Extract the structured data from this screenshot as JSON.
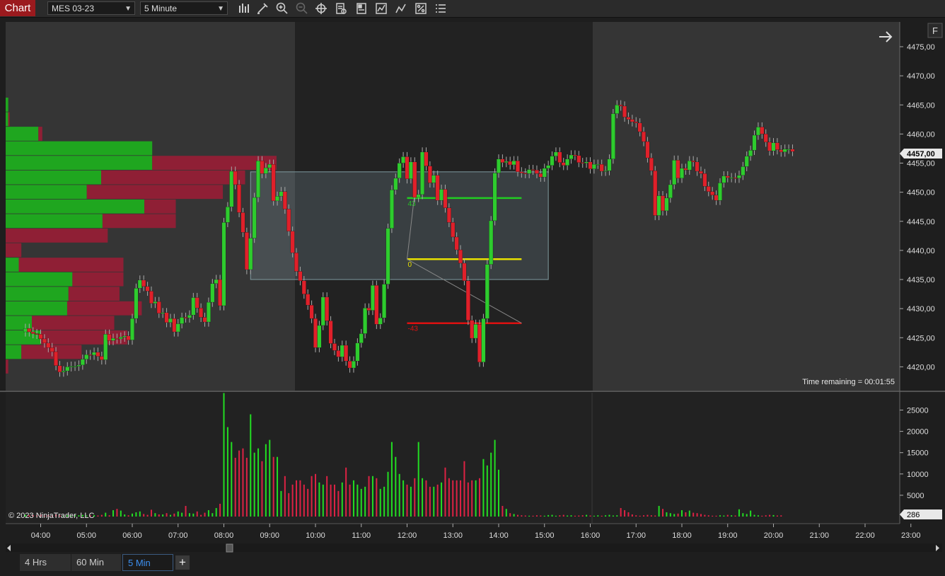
{
  "toolbar": {
    "chart_tab": "Chart",
    "instrument": "MES 03-23",
    "interval": "5 Minute",
    "icons": [
      "bar-type-icon",
      "drawing-tool-icon",
      "zoom-in-icon",
      "zoom-out-icon",
      "crosshair-icon",
      "data-box-icon",
      "properties-icon",
      "strategies-icon",
      "indicators-icon",
      "trade-icon",
      "chart-trader-icon"
    ]
  },
  "chart": {
    "time_remaining": "Time remaining = 00:01:55",
    "copyright": "© 2023 NinjaTrader, LLC",
    "last_price_label": "4457,00",
    "last_volume_label": "286",
    "f_button": "F",
    "colors": {
      "up": "#2ecc2e",
      "down": "#e0202a",
      "bg_extended": "#353535",
      "bg_rth": "#222222",
      "volume_up": "#22dd22",
      "volume_down": "#dd2244"
    },
    "price_ticks": [
      "4475,00",
      "4470,00",
      "4465,00",
      "4460,00",
      "4455,00",
      "4450,00",
      "4445,00",
      "4440,00",
      "4435,00",
      "4430,00",
      "4425,00",
      "4420,00"
    ],
    "volume_ticks": [
      "25000",
      "20000",
      "15000",
      "10000",
      "5000"
    ],
    "time_ticks": [
      "04:00",
      "05:00",
      "06:00",
      "07:00",
      "08:00",
      "09:00",
      "10:00",
      "11:00",
      "12:00",
      "13:00",
      "14:00",
      "15:00",
      "16:00",
      "17:00",
      "18:00",
      "19:00",
      "20:00",
      "21:00",
      "22:00",
      "23:00"
    ],
    "fib_labels": {
      "top": "43",
      "mid": "0",
      "bottom": "-43"
    }
  },
  "chart_data": {
    "type": "candlestick",
    "session_start": "03:40",
    "bar_minutes": 5,
    "price_range": [
      4416.5,
      4477.5
    ],
    "volume_range": [
      0,
      29000
    ],
    "rth_session": [
      "09:30",
      "16:00"
    ],
    "closes": [
      4426.6,
      4426.0,
      4425.7,
      4425.6,
      4424.8,
      4424.1,
      4423.3,
      4422.6,
      4420.2,
      4419.1,
      4419.3,
      4420.0,
      4420.1,
      4420.1,
      4420.3,
      4421.3,
      4422.1,
      4422.0,
      4422.5,
      4421.8,
      4421.2,
      4425.6,
      4424.5,
      4424.9,
      4424.8,
      4425.1,
      4425.3,
      4424.6,
      4428.3,
      4433.5,
      4434.9,
      4433.8,
      4433.0,
      4430.9,
      4431.2,
      4429.2,
      4429.3,
      4427.6,
      4428.3,
      4426.0,
      4427.4,
      4428.5,
      4428.4,
      4428.9,
      4431.9,
      4430.1,
      4428.5,
      4427.7,
      4431.1,
      4434.3,
      4435.0,
      4430.5,
      4444.8,
      4447.5,
      4453.6,
      4451.3,
      4446.5,
      4443.1,
      4436.7,
      4442.1,
      4449.1,
      4455.4,
      4453.2,
      4454.2,
      4454.8,
      4448.5,
      4449.3,
      4450.1,
      4447.1,
      4443.3,
      4439.6,
      4436.4,
      4434.8,
      4432.5,
      4430.6,
      4428.3,
      4423.3,
      4427.1,
      4432.0,
      4427.9,
      4424.0,
      4422.8,
      4421.7,
      4423.7,
      4421.0,
      4419.8,
      4421.0,
      4424.1,
      4425.7,
      4430.1,
      4429.7,
      4434.0,
      4427.3,
      4428.4,
      4434.2,
      4443.8,
      4450.4,
      4452.4,
      4455.0,
      4456.1,
      4452.3,
      4455.2,
      4449.1,
      4449.6,
      4456.9,
      4454.5,
      4451.6,
      4452.9,
      4448.6,
      4450.5,
      4447.3,
      4444.8,
      4442.3,
      4440.1,
      4437.8,
      4434.8,
      4428.0,
      4424.9,
      4427.3,
      4420.8,
      4428.3,
      4437.6,
      4445.1,
      4453.3,
      4455.7,
      4455.1,
      4455.3,
      4454.7,
      4455.4,
      4453.5,
      4453.3,
      4453.2,
      4453.9,
      4453.8,
      4453.2,
      4452.6,
      4454.1,
      4454.6,
      4456.2,
      4456.9,
      4455.1,
      4454.6,
      4455.7,
      4456.4,
      4456.3,
      4455.1,
      4455.0,
      4455.2,
      4454.0,
      4454.8,
      4454.8,
      4453.6,
      4453.7,
      4455.7,
      4463.5,
      4465.0,
      4464.8,
      4462.9,
      4462.5,
      4462.1,
      4461.9,
      4460.4,
      4458.7,
      4455.9,
      4453.7,
      4446.0,
      4449.4,
      4446.8,
      4449.0,
      4451.3,
      4455.5,
      4452.4,
      4454.1,
      4453.8,
      4455.4,
      4455.2,
      4453.6,
      4453.2,
      4451.0,
      4450.1,
      4449.5,
      4448.6,
      4451.6,
      4452.8,
      4452.5,
      4452.5,
      4452.4,
      4452.9,
      4454.4,
      4456.2,
      4457.2,
      4459.8,
      4461.2,
      4460.0,
      4458.6,
      4457.1,
      4458.5,
      4457.3,
      4456.9,
      4457.4,
      4457.4,
      4457.0
    ],
    "volumes": [
      400,
      300,
      350,
      250,
      450,
      200,
      300,
      250,
      500,
      250,
      200,
      300,
      250,
      350,
      300,
      400,
      250,
      300,
      350,
      250,
      400,
      900,
      300,
      1500,
      1800,
      1400,
      500,
      300,
      700,
      1000,
      1200,
      600,
      400,
      1600,
      800,
      500,
      500,
      800,
      400,
      700,
      1200,
      900,
      2500,
      800,
      700,
      1200,
      400,
      900,
      1500,
      800,
      2000,
      3000,
      29000,
      21000,
      17500,
      13800,
      15500,
      16000,
      13800,
      24000,
      15000,
      16000,
      13000,
      17000,
      18000,
      14000,
      14000,
      6000,
      9500,
      5500,
      7500,
      8500,
      8500,
      7500,
      6500,
      9500,
      10000,
      8000,
      7500,
      9500,
      7500,
      7500,
      6000,
      8000,
      11500,
      7500,
      8500,
      7500,
      6500,
      7000,
      9500,
      9500,
      9000,
      6500,
      7000,
      10500,
      17500,
      14000,
      10000,
      8500,
      7500,
      7000,
      9000,
      17500,
      9000,
      8500,
      7000,
      7000,
      7500,
      8000,
      11500,
      9000,
      8500,
      8500,
      8500,
      13000,
      8000,
      8500,
      8500,
      9000,
      13500,
      12000,
      15000,
      18000,
      11000,
      2500,
      1800,
      800,
      600,
      400,
      300,
      250,
      200,
      200,
      300,
      250,
      200,
      350,
      400,
      200,
      300,
      400,
      250,
      300,
      200,
      250,
      300,
      400,
      250,
      200,
      300,
      200,
      300,
      400,
      250,
      300,
      2000,
      1500,
      1000,
      500,
      300,
      200,
      300,
      400,
      300,
      250,
      2500,
      1800,
      1000,
      800,
      600,
      700,
      1500,
      1000,
      1400,
      900,
      800,
      600,
      400,
      300,
      200,
      200,
      300,
      250,
      400,
      300,
      250,
      1700,
      800,
      600,
      1400,
      400,
      300,
      200,
      300,
      400,
      350,
      250,
      286
    ],
    "volume_profile": [
      {
        "price": 4465,
        "buy": 2,
        "sell": 0
      },
      {
        "price": 4462.5,
        "buy": 2,
        "sell": 1
      },
      {
        "price": 4460,
        "buy": 25,
        "sell": 3
      },
      {
        "price": 4457.5,
        "buy": 112,
        "sell": 0
      },
      {
        "price": 4455,
        "buy": 112,
        "sell": 95
      },
      {
        "price": 4452.5,
        "buy": 73,
        "sell": 110
      },
      {
        "price": 4450,
        "buy": 62,
        "sell": 104
      },
      {
        "price": 4447.5,
        "buy": 106,
        "sell": 24
      },
      {
        "price": 4445,
        "buy": 74,
        "sell": 56
      },
      {
        "price": 4442.5,
        "buy": 0,
        "sell": 78
      },
      {
        "price": 4440,
        "buy": 0,
        "sell": 12
      },
      {
        "price": 4437.5,
        "buy": 10,
        "sell": 80
      },
      {
        "price": 4435,
        "buy": 51,
        "sell": 39
      },
      {
        "price": 4432.5,
        "buy": 48,
        "sell": 39
      },
      {
        "price": 4430,
        "buy": 47,
        "sell": 57
      },
      {
        "price": 4427.5,
        "buy": 20,
        "sell": 63
      },
      {
        "price": 4425,
        "buy": 27,
        "sell": 66
      },
      {
        "price": 4422.5,
        "buy": 12,
        "sell": 46
      },
      {
        "price": 4420,
        "buy": 0,
        "sell": 2
      }
    ],
    "overlays": {
      "rectangle": {
        "time_start": "08:35",
        "time_end": "15:05",
        "price_top": 4453.5,
        "price_bottom": 4435.0
      },
      "fib_levels": [
        {
          "label": "43",
          "price": 4449.0,
          "color": "#22cc22",
          "time_start": "12:00",
          "time_end": "14:30"
        },
        {
          "label": "0",
          "price": 4438.5,
          "color": "#e8e000",
          "time_start": "12:00",
          "time_end": "14:30"
        },
        {
          "label": "-43",
          "price": 4427.5,
          "color": "#dd1111",
          "time_start": "12:00",
          "time_end": "14:30"
        }
      ]
    }
  },
  "bottom_tabs": {
    "tabs": [
      {
        "label": "4 Hrs"
      },
      {
        "label": "60 Min"
      },
      {
        "label": "5 Min"
      }
    ],
    "active": "5 Min",
    "add": "+"
  }
}
